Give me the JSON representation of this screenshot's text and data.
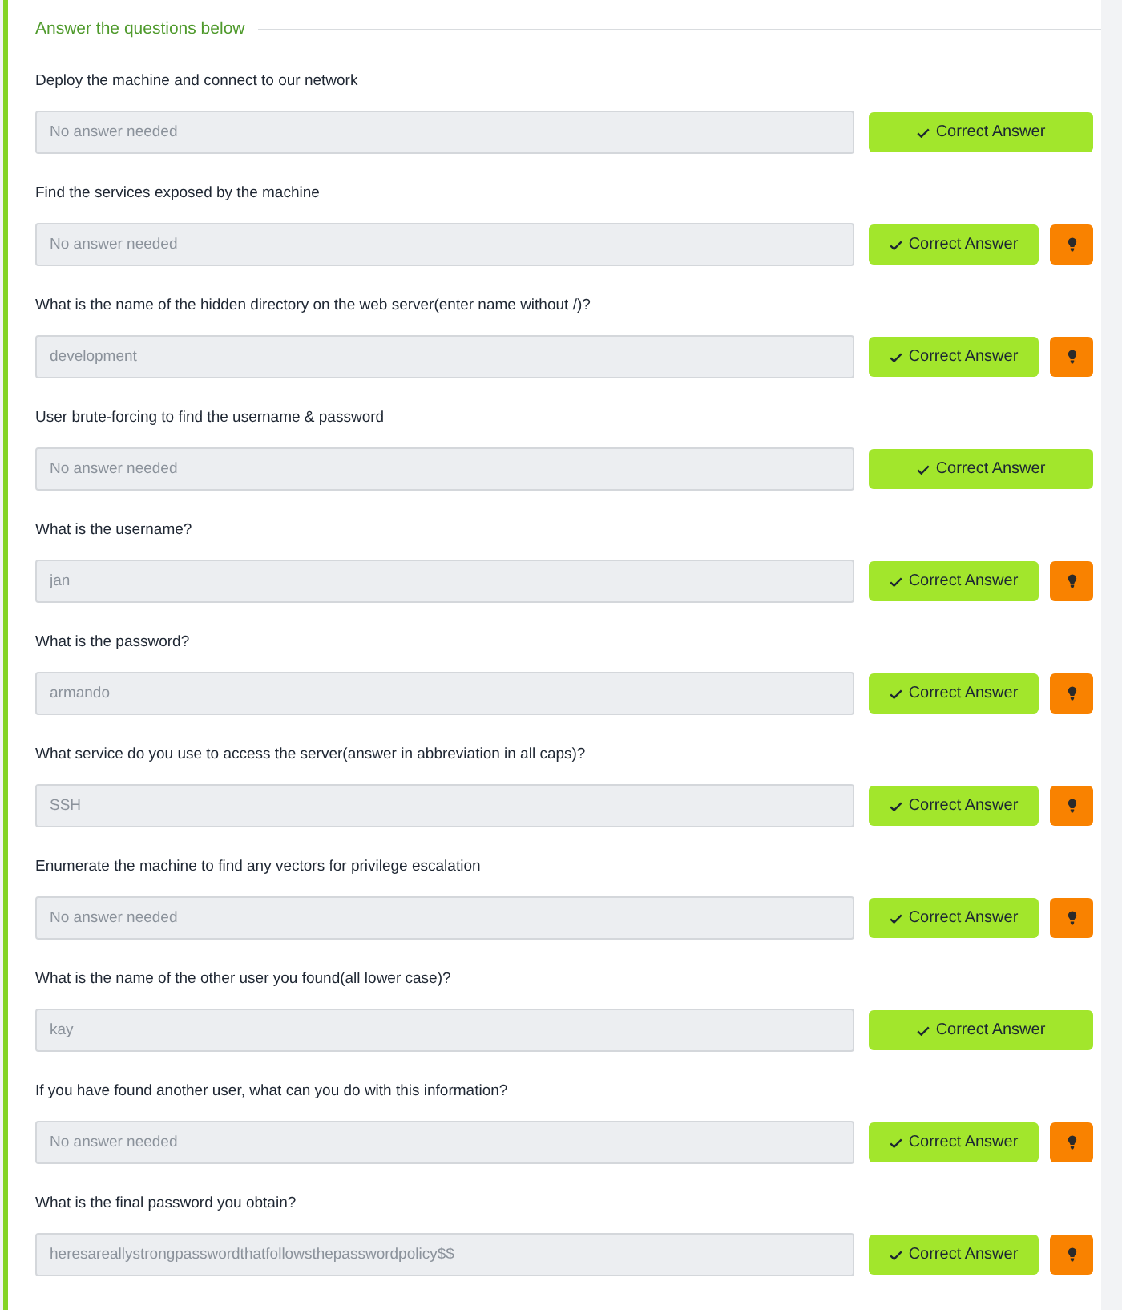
{
  "section": {
    "title": "Answer the questions below"
  },
  "questions": [
    {
      "question": "Deploy the machine and connect to our network",
      "answer": "No answer needed",
      "button": "Correct Answer",
      "hint": false
    },
    {
      "question": "Find the services exposed by the machine",
      "answer": "No answer needed",
      "button": "Correct Answer",
      "hint": true
    },
    {
      "question": "What is the name of the hidden directory on the web server(enter name without /)?",
      "answer": "development",
      "button": "Correct Answer",
      "hint": true
    },
    {
      "question": "User brute-forcing to find the username & password",
      "answer": "No answer needed",
      "button": "Correct Answer",
      "hint": false
    },
    {
      "question": "What is the username?",
      "answer": "jan",
      "button": "Correct Answer",
      "hint": true
    },
    {
      "question": "What is the password?",
      "answer": "armando",
      "button": "Correct Answer",
      "hint": true
    },
    {
      "question": "What service do you use to access the server(answer in abbreviation in all caps)?",
      "answer": "SSH",
      "button": "Correct Answer",
      "hint": true
    },
    {
      "question": "Enumerate the machine to find any vectors for privilege escalation",
      "answer": "No answer needed",
      "button": "Correct Answer",
      "hint": true
    },
    {
      "question": "What is the name of the other user you found(all lower case)?",
      "answer": "kay",
      "button": "Correct Answer",
      "hint": false
    },
    {
      "question": "If you have found another user, what can you do with this information?",
      "answer": "No answer needed",
      "button": "Correct Answer",
      "hint": true
    },
    {
      "question": "What is the final password you obtain?",
      "answer": "heresareallystrongpasswordthatfollowsthepasswordpolicy$$",
      "button": "Correct Answer",
      "hint": true
    }
  ]
}
